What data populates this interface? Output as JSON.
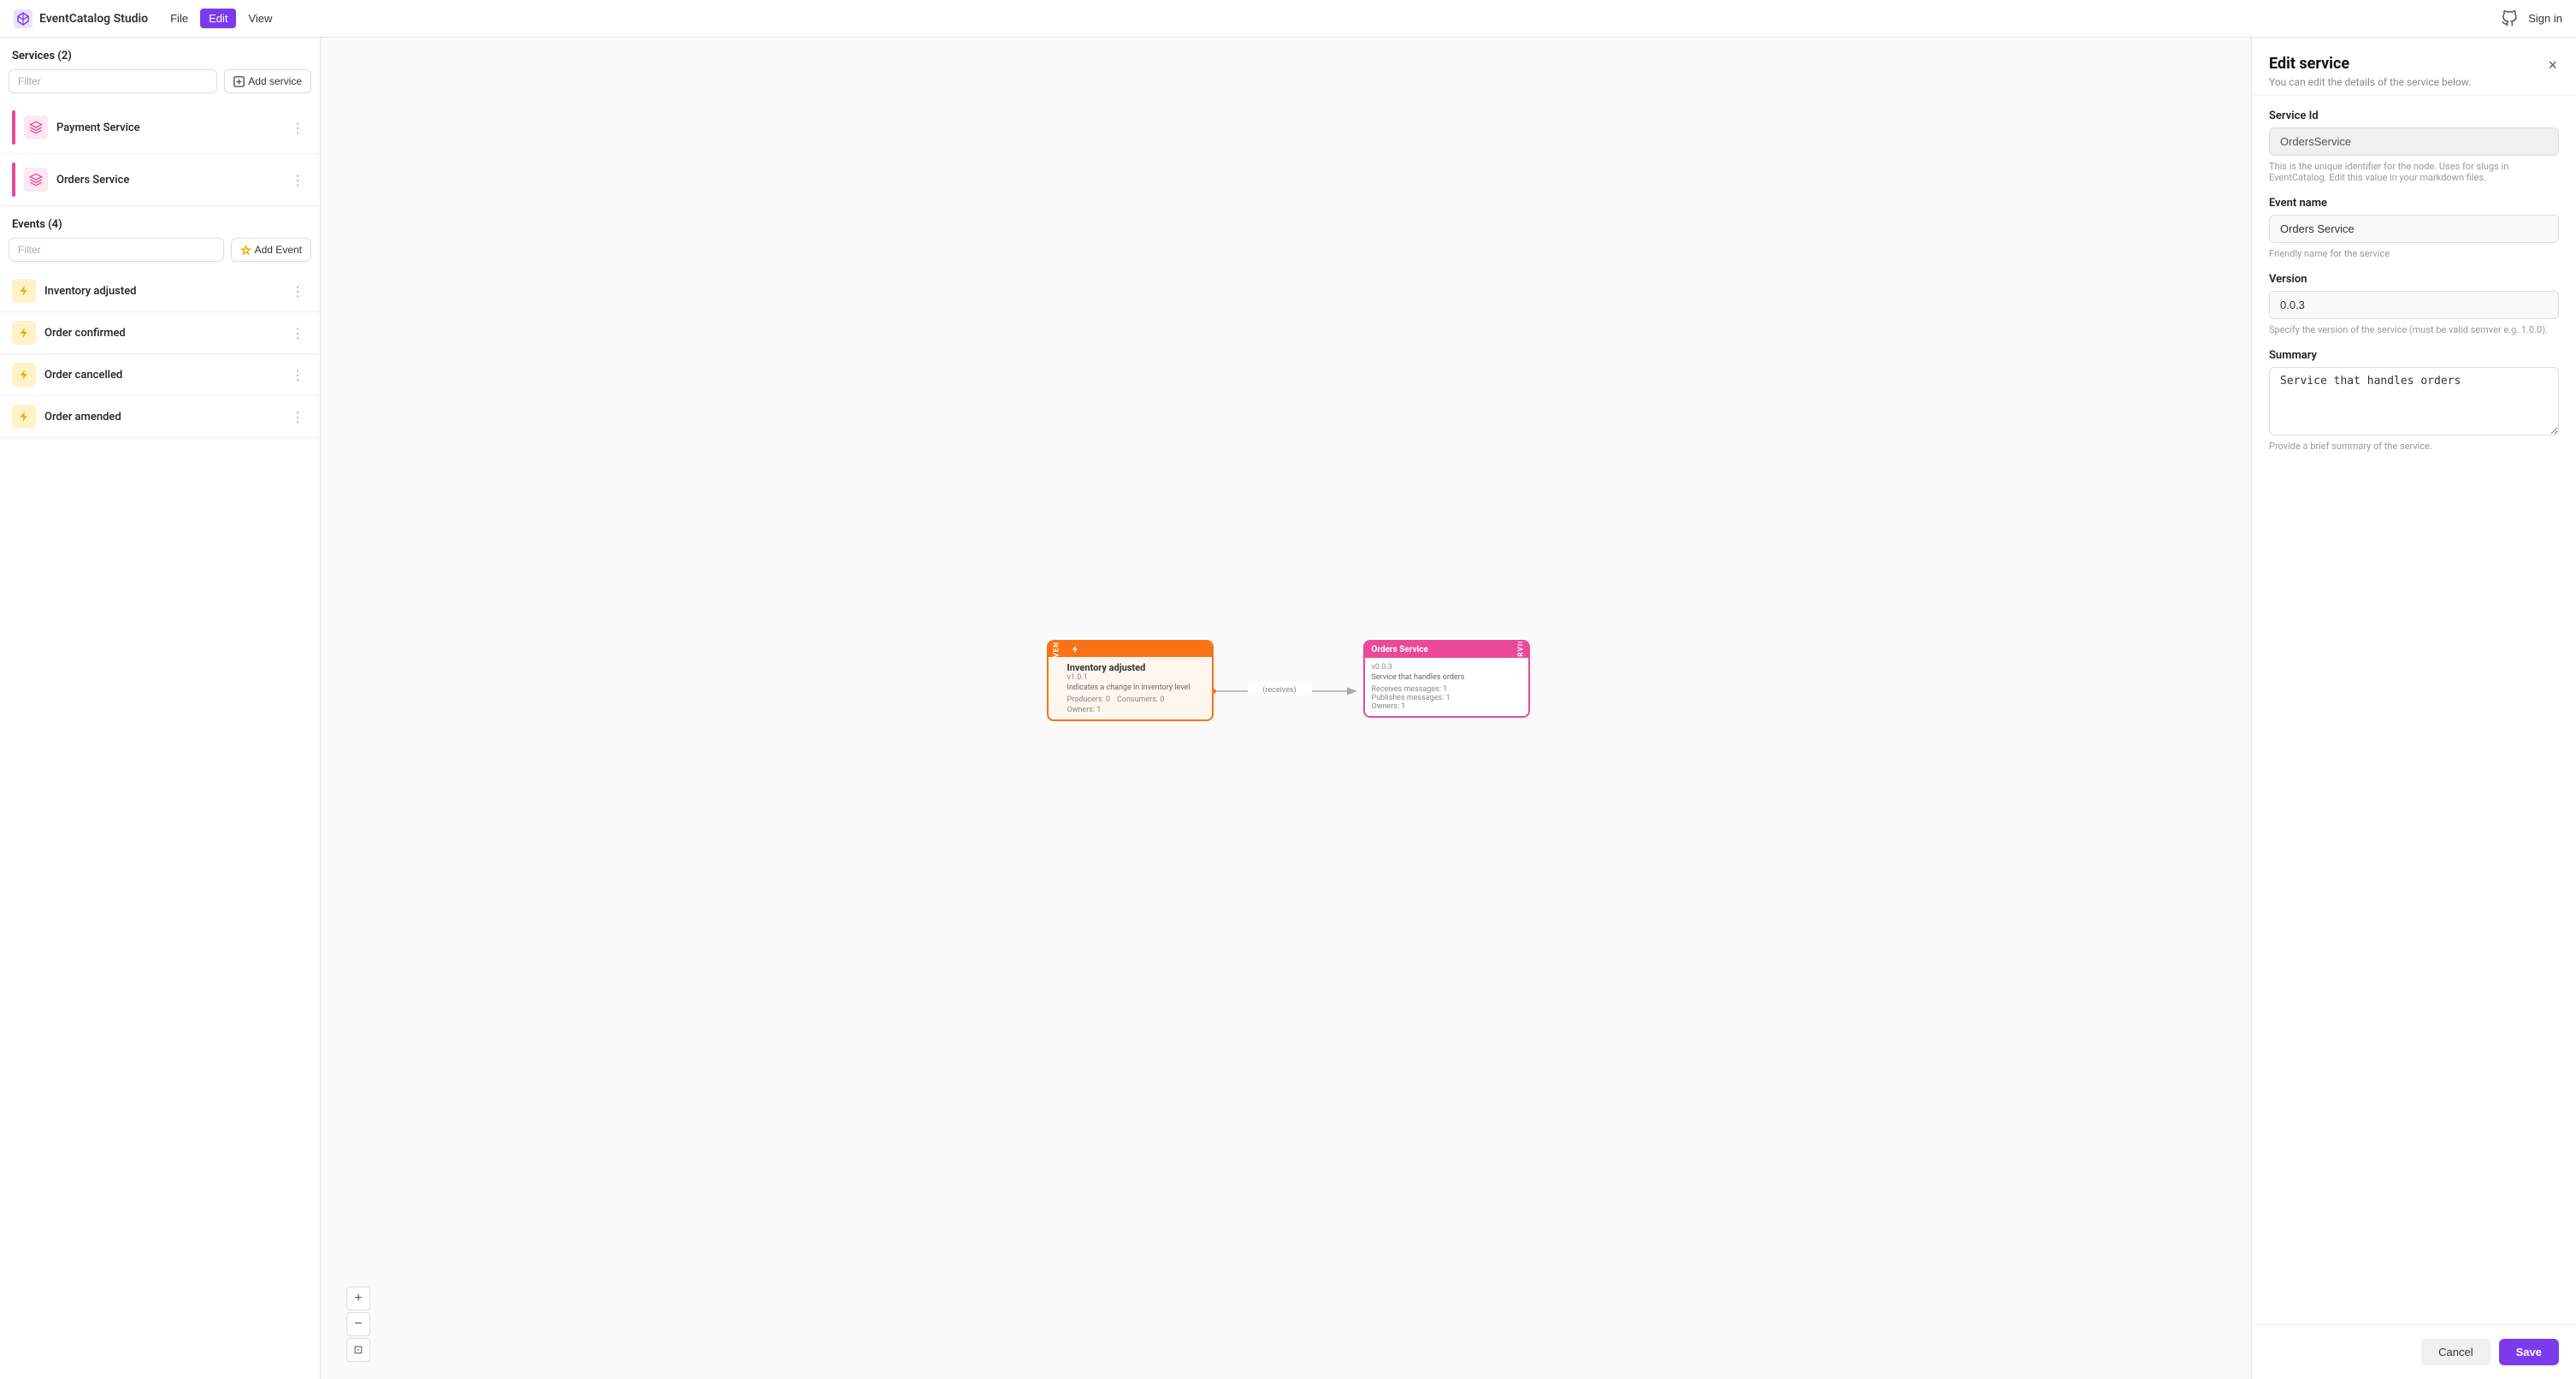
{
  "app": {
    "name": "EventCatalog Studio",
    "nav": [
      "File",
      "Edit",
      "View"
    ],
    "active_nav": "Edit",
    "sign_in": "Sign in"
  },
  "sidebar": {
    "services_header": "Services (2)",
    "events_header": "Events (4)",
    "filter_placeholder": "Filter",
    "add_service_label": "Add service",
    "add_event_label": "Add Event",
    "services": [
      {
        "id": "payment-service",
        "name": "Payment Service",
        "color": "pink"
      },
      {
        "id": "orders-service",
        "name": "Orders Service",
        "color": "pink"
      }
    ],
    "events": [
      {
        "id": "inventory-adjusted",
        "name": "Inventory adjusted"
      },
      {
        "id": "order-confirmed",
        "name": "Order confirmed"
      },
      {
        "id": "order-cancelled",
        "name": "Order cancelled"
      },
      {
        "id": "order-amended",
        "name": "Order amended"
      }
    ]
  },
  "canvas": {
    "event_node": {
      "label": "EVENT",
      "title": "Inventory adjusted",
      "version": "v1.0.1",
      "description": "Indicates a change in inventory level",
      "producers": "Producers: 0",
      "consumers": "Consumers: 0",
      "owners": "Owners: 1"
    },
    "arrow_label": "(receives)",
    "service_node": {
      "label": "SERVICE",
      "title": "Orders Service",
      "version": "v0.0.3",
      "description": "Service that handles orders",
      "receives": "Receives messages: 1",
      "publishes": "Publishes messages: 1",
      "owners": "Owners: 1"
    },
    "controls": {
      "zoom_in": "+",
      "zoom_out": "−",
      "fit": "⊡"
    }
  },
  "edit_panel": {
    "title": "Edit service",
    "subtitle": "You can edit the details of the service below.",
    "close_label": "×",
    "service_id_label": "Service Id",
    "service_id_value": "OrdersService",
    "service_id_hint": "This is the unique identifier for the node. Uses for slugs in EventCatalog. Edit this value in your markdown files.",
    "event_name_label": "Event name",
    "event_name_value": "Orders Service",
    "event_name_hint": "Friendly name for the service",
    "version_label": "Version",
    "version_value": "0.0.3",
    "version_hint": "Specify the version of the service (must be valid semver e.g. 1.0.0).",
    "summary_label": "Summary",
    "summary_value": "Service that handles orders",
    "summary_hint": "Provide a brief summary of the service.",
    "cancel_label": "Cancel",
    "save_label": "Save"
  }
}
